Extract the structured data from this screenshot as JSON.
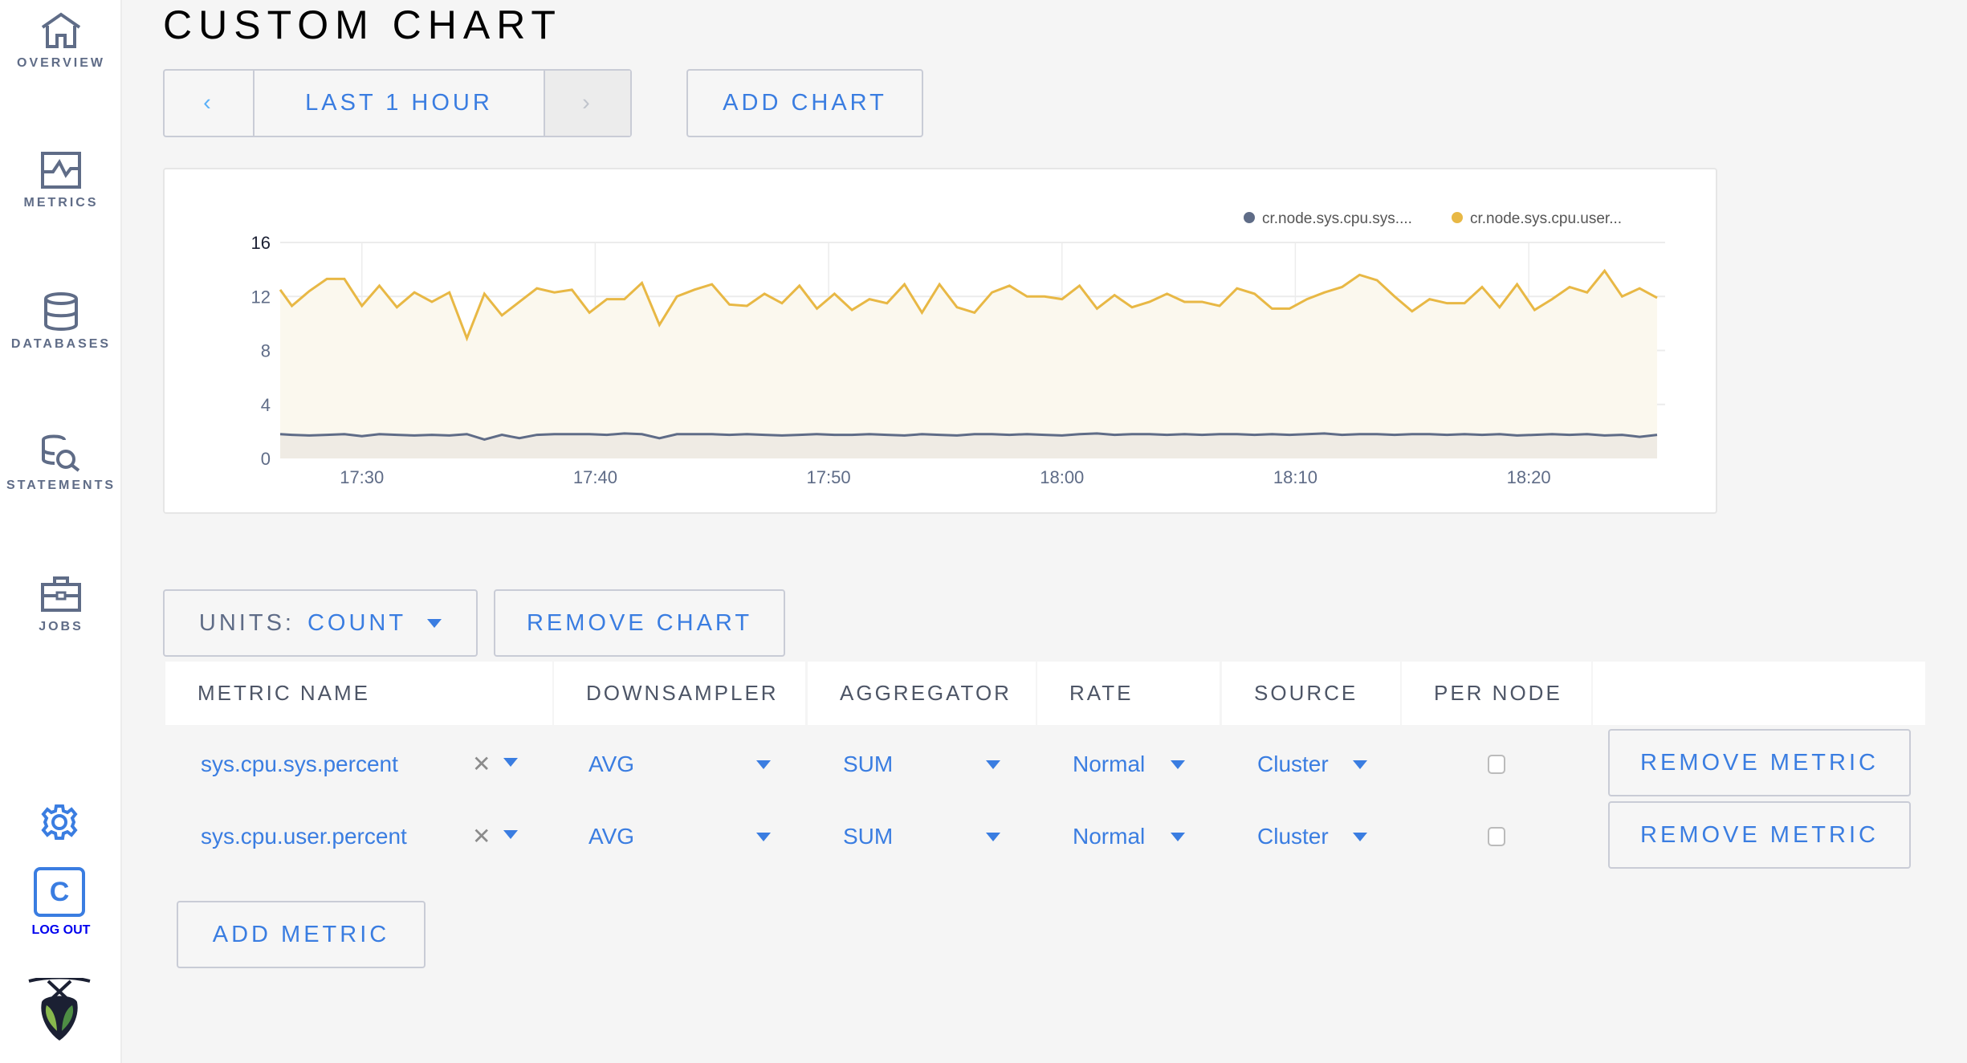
{
  "sidebar": {
    "items": [
      {
        "label": "OVERVIEW",
        "icon": "home-icon"
      },
      {
        "label": "METRICS",
        "icon": "metrics-icon"
      },
      {
        "label": "DATABASES",
        "icon": "database-icon"
      },
      {
        "label": "STATEMENTS",
        "icon": "statements-icon"
      },
      {
        "label": "JOBS",
        "icon": "briefcase-icon"
      }
    ],
    "settings_icon": "gear-icon",
    "user_initial": "C",
    "logout_label": "LOG OUT",
    "logo": "cockroach-logo"
  },
  "page": {
    "title": "CUSTOM CHART"
  },
  "toolbar": {
    "prev": "‹",
    "range": "LAST 1 HOUR",
    "next": "›",
    "add_chart": "ADD CHART"
  },
  "controls": {
    "units_label": "UNITS:",
    "units_value": "COUNT",
    "remove_chart": "REMOVE CHART"
  },
  "table": {
    "headers": [
      "METRIC NAME",
      "DOWNSAMPLER",
      "AGGREGATOR",
      "RATE",
      "SOURCE",
      "PER NODE"
    ],
    "rows": [
      {
        "metric": "sys.cpu.sys.percent",
        "downsampler": "AVG",
        "aggregator": "SUM",
        "rate": "Normal",
        "source": "Cluster",
        "per_node": false,
        "remove": "REMOVE METRIC"
      },
      {
        "metric": "sys.cpu.user.percent",
        "downsampler": "AVG",
        "aggregator": "SUM",
        "rate": "Normal",
        "source": "Cluster",
        "per_node": false,
        "remove": "REMOVE METRIC"
      }
    ],
    "clear_glyph": "✕",
    "add_metric": "ADD METRIC"
  },
  "colors": {
    "accent": "#3a7de1",
    "sys": "#5f6c87",
    "user": "#e8b845"
  },
  "chart_data": {
    "type": "area",
    "ylim": [
      0,
      16
    ],
    "yticks": [
      "0",
      "4",
      "8",
      "12",
      "16"
    ],
    "xticks": [
      "17:30",
      "17:40",
      "17:50",
      "18:00",
      "18:10",
      "18:20"
    ],
    "xlim": [
      "17:26:15",
      "18:25:30"
    ],
    "grid": true,
    "legend_position": "top-right",
    "x": [
      "17:26:15",
      "17:27:00",
      "17:27:45",
      "17:28:30",
      "17:29:15",
      "17:30:00",
      "17:30:45",
      "17:31:30",
      "17:32:15",
      "17:33:00",
      "17:33:45",
      "17:34:30",
      "17:35:15",
      "17:36:00",
      "17:36:45",
      "17:37:30",
      "17:38:15",
      "17:39:00",
      "17:39:45",
      "17:40:30",
      "17:41:15",
      "17:42:00",
      "17:42:45",
      "17:43:30",
      "17:44:15",
      "17:45:00",
      "17:45:45",
      "17:46:30",
      "17:47:15",
      "17:48:00",
      "17:48:45",
      "17:49:30",
      "17:50:15",
      "17:51:00",
      "17:51:45",
      "17:52:30",
      "17:53:15",
      "17:54:00",
      "17:54:45",
      "17:55:30",
      "17:56:15",
      "17:57:00",
      "17:57:45",
      "17:58:30",
      "17:59:15",
      "18:00:00",
      "18:00:45",
      "18:01:30",
      "18:02:15",
      "18:03:00",
      "18:03:45",
      "18:04:30",
      "18:05:15",
      "18:06:00",
      "18:06:45",
      "18:07:30",
      "18:08:15",
      "18:09:00",
      "18:09:45",
      "18:10:30",
      "18:11:15",
      "18:12:00",
      "18:12:45",
      "18:13:30",
      "18:14:15",
      "18:15:00",
      "18:15:45",
      "18:16:30",
      "18:17:15",
      "18:18:00",
      "18:18:45",
      "18:19:30",
      "18:20:15",
      "18:21:00",
      "18:21:45",
      "18:22:30",
      "18:23:15",
      "18:24:00",
      "18:24:45",
      "18:25:30"
    ],
    "series": [
      {
        "name": "cr.node.sys.cpu.sys....",
        "color": "#5f6c87",
        "values": [
          1.8,
          1.75,
          1.7,
          1.75,
          1.8,
          1.65,
          1.8,
          1.75,
          1.7,
          1.75,
          1.7,
          1.8,
          1.4,
          1.75,
          1.5,
          1.75,
          1.8,
          1.8,
          1.8,
          1.75,
          1.85,
          1.8,
          1.5,
          1.8,
          1.8,
          1.8,
          1.75,
          1.8,
          1.75,
          1.7,
          1.75,
          1.8,
          1.75,
          1.75,
          1.8,
          1.75,
          1.7,
          1.8,
          1.75,
          1.7,
          1.8,
          1.8,
          1.75,
          1.8,
          1.75,
          1.7,
          1.8,
          1.85,
          1.75,
          1.8,
          1.8,
          1.75,
          1.8,
          1.75,
          1.8,
          1.8,
          1.75,
          1.8,
          1.75,
          1.8,
          1.85,
          1.75,
          1.8,
          1.8,
          1.75,
          1.8,
          1.8,
          1.75,
          1.8,
          1.75,
          1.8,
          1.7,
          1.75,
          1.8,
          1.75,
          1.8,
          1.7,
          1.75,
          1.6,
          1.75
        ]
      },
      {
        "name": "cr.node.sys.cpu.user...",
        "color": "#e8b845",
        "values": [
          12.5,
          11.3,
          12.4,
          13.3,
          13.3,
          11.3,
          12.8,
          11.2,
          12.3,
          11.6,
          12.3,
          8.9,
          12.2,
          10.6,
          11.6,
          12.6,
          12.3,
          12.5,
          10.8,
          11.8,
          11.8,
          13.0,
          9.9,
          12.0,
          12.5,
          12.9,
          11.4,
          11.3,
          12.2,
          11.5,
          12.8,
          11.1,
          12.2,
          11.0,
          11.8,
          11.5,
          12.9,
          10.8,
          12.9,
          11.2,
          10.8,
          12.3,
          12.8,
          12.0,
          12.0,
          11.8,
          12.8,
          11.1,
          12.1,
          11.2,
          11.6,
          12.2,
          11.6,
          11.6,
          11.3,
          12.6,
          12.2,
          11.1,
          11.1,
          11.8,
          12.3,
          12.7,
          13.6,
          13.2,
          12.0,
          10.9,
          11.8,
          11.5,
          11.5,
          12.7,
          11.2,
          12.9,
          11.0,
          11.8,
          12.7,
          12.3,
          13.9,
          12.0,
          12.6,
          11.9
        ]
      }
    ]
  }
}
